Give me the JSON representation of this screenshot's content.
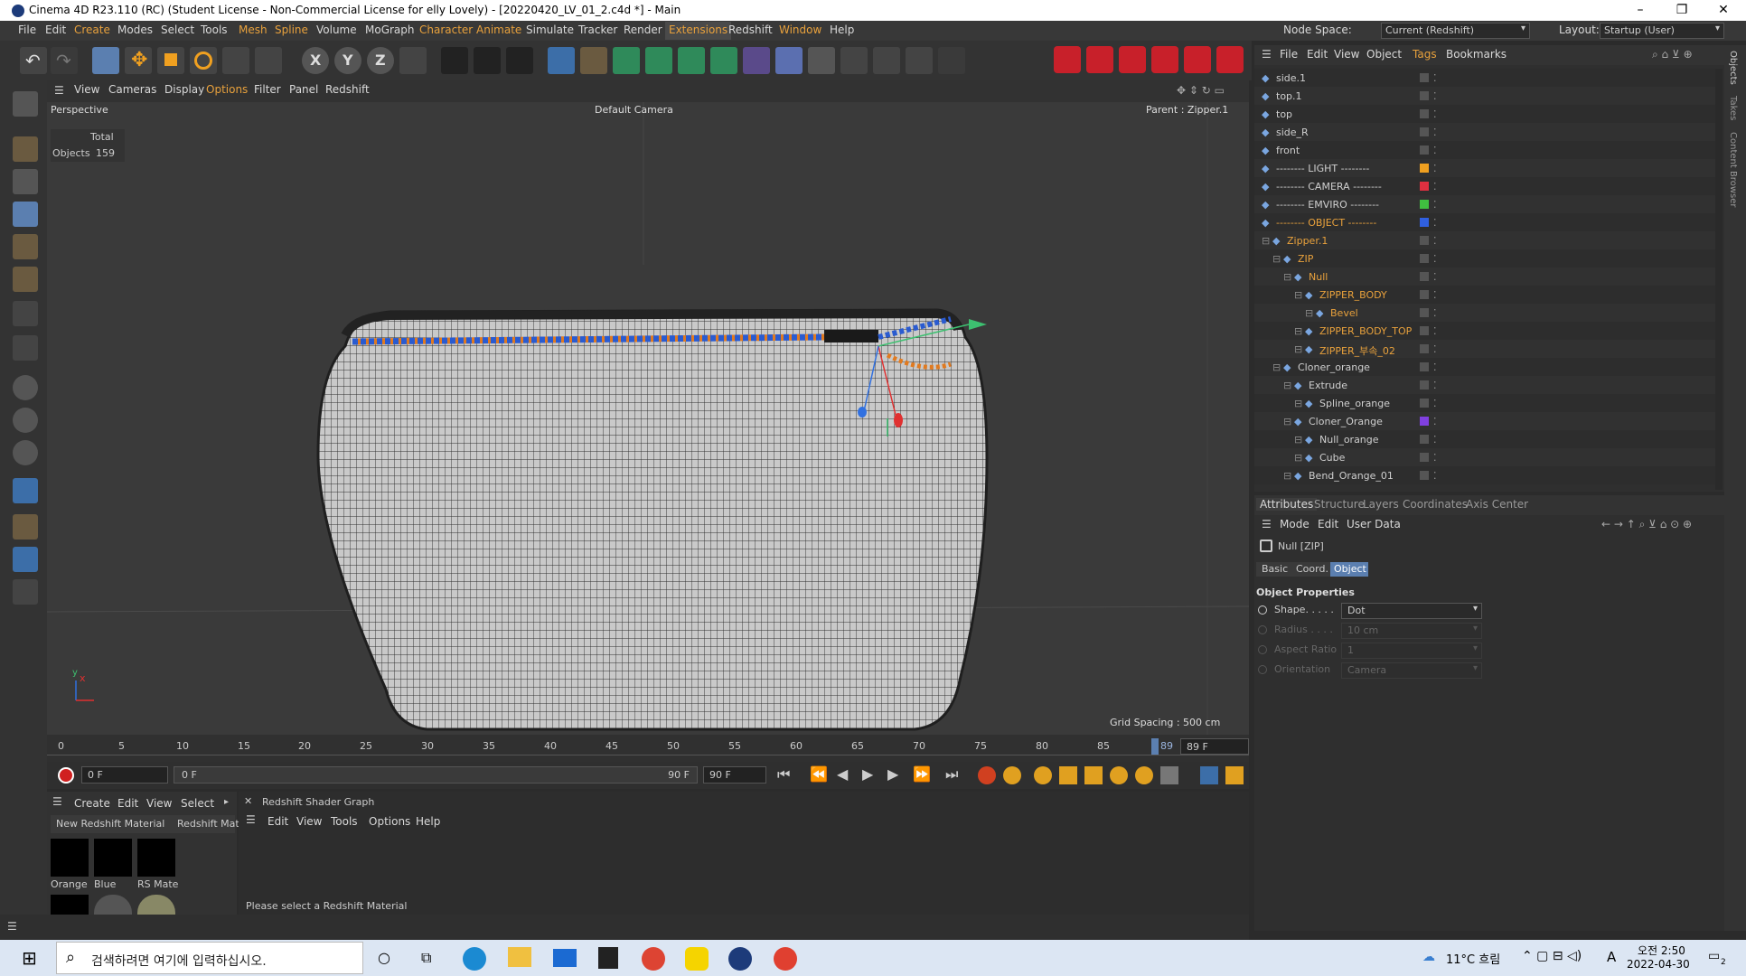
{
  "window": {
    "title": "Cinema 4D R23.110 (RC) (Student License - Non-Commercial License for elly Lovely) - [20220420_LV_01_2.c4d *] - Main",
    "controls": [
      "–",
      "❐",
      "✕"
    ]
  },
  "menubar": {
    "items": [
      "File",
      "Edit",
      "Create",
      "Modes",
      "Select",
      "Tools",
      "Mesh",
      "Spline",
      "Volume",
      "MoGraph",
      "Character",
      "Animate",
      "Simulate",
      "Tracker",
      "Render",
      "Extensions",
      "Redshift",
      "Window",
      "Help"
    ],
    "node_space_label": "Node Space:",
    "node_space_value": "Current (Redshift)",
    "layout_label": "Layout:",
    "layout_value": "Startup (User)"
  },
  "viewport_menu": {
    "items": [
      "View",
      "Cameras",
      "Display",
      "Options",
      "Filter",
      "Panel",
      "Redshift"
    ]
  },
  "viewport": {
    "mode": "Perspective",
    "camera": "Default Camera",
    "parent": "Parent : Zipper.1",
    "stats_header": "Total",
    "stats_label": "Objects",
    "stats_value": "159",
    "grid_spacing": "Grid Spacing : 500 cm",
    "axis_x": "x",
    "axis_y": "y"
  },
  "timeline": {
    "ticks": [
      "0",
      "5",
      "10",
      "15",
      "20",
      "25",
      "30",
      "35",
      "40",
      "45",
      "50",
      "55",
      "60",
      "65",
      "70",
      "75",
      "80",
      "85"
    ],
    "current_marker": "89",
    "end_frame": "89 F"
  },
  "transport": {
    "current_frame": "0 F",
    "range_start": "0 F",
    "range_end": "90 F",
    "max_frame": "90 F"
  },
  "material_panel": {
    "menu": [
      "Create",
      "Edit",
      "View",
      "Select"
    ],
    "tabs": [
      "New Redshift Material",
      "Redshift Mate"
    ],
    "materials": [
      {
        "label": "Orange",
        "color": "#000000"
      },
      {
        "label": "Blue",
        "color": "#000000"
      },
      {
        "label": "RS Mate",
        "color": "#000000"
      }
    ]
  },
  "shader_graph": {
    "title": "Redshift Shader Graph",
    "menu": [
      "Edit",
      "View",
      "Tools",
      "Options",
      "Help"
    ],
    "status": "Please select a Redshift Material"
  },
  "object_manager": {
    "menu": [
      "File",
      "Edit",
      "View",
      "Object",
      "Tags",
      "Bookmarks"
    ],
    "rows": [
      {
        "name": "side.1",
        "indent": 0,
        "color": "#cfcfcf",
        "icon": "camera-icon",
        "layer": ""
      },
      {
        "name": "top.1",
        "indent": 0,
        "color": "#cfcfcf",
        "icon": "camera-icon",
        "layer": ""
      },
      {
        "name": "top",
        "indent": 0,
        "color": "#cfcfcf",
        "icon": "camera-icon",
        "layer": ""
      },
      {
        "name": "side_R",
        "indent": 0,
        "color": "#cfcfcf",
        "icon": "camera-icon",
        "layer": ""
      },
      {
        "name": "front",
        "indent": 0,
        "color": "#cfcfcf",
        "icon": "camera-icon",
        "layer": ""
      },
      {
        "name": "-------- LIGHT --------",
        "indent": 0,
        "color": "#cfcfcf",
        "icon": "folder-icon",
        "layer": "#f0a020"
      },
      {
        "name": "-------- CAMERA --------",
        "indent": 0,
        "color": "#cfcfcf",
        "icon": "folder-icon",
        "layer": "#e03040"
      },
      {
        "name": "-------- EMVIRO --------",
        "indent": 0,
        "color": "#cfcfcf",
        "icon": "folder-icon",
        "layer": "#40c040"
      },
      {
        "name": "-------- OBJECT --------",
        "indent": 0,
        "color": "#e8a13c",
        "icon": "folder-icon",
        "layer": "#3060e0"
      },
      {
        "name": "Zipper.1",
        "indent": 1,
        "color": "#e8a13c",
        "icon": "null-icon",
        "layer": ""
      },
      {
        "name": "ZIP",
        "indent": 2,
        "color": "#e8a13c",
        "icon": "null-icon",
        "layer": ""
      },
      {
        "name": "Null",
        "indent": 3,
        "color": "#e8a13c",
        "icon": "null-icon",
        "layer": ""
      },
      {
        "name": "ZIPPER_BODY",
        "indent": 4,
        "color": "#e8a13c",
        "icon": "mesh-icon",
        "layer": ""
      },
      {
        "name": "Bevel",
        "indent": 5,
        "color": "#e8a13c",
        "icon": "bevel-icon",
        "layer": ""
      },
      {
        "name": "ZIPPER_BODY_TOP",
        "indent": 4,
        "color": "#e8a13c",
        "icon": "mesh-icon",
        "layer": ""
      },
      {
        "name": "ZIPPER_부속_02",
        "indent": 4,
        "color": "#e8a13c",
        "icon": "mesh-icon",
        "layer": ""
      },
      {
        "name": "Cloner_orange",
        "indent": 2,
        "color": "#cfcfcf",
        "icon": "null-icon",
        "layer": ""
      },
      {
        "name": "Extrude",
        "indent": 3,
        "color": "#cfcfcf",
        "icon": "extrude-icon",
        "layer": ""
      },
      {
        "name": "Spline_orange",
        "indent": 4,
        "color": "#cfcfcf",
        "icon": "spline-icon",
        "layer": ""
      },
      {
        "name": "Cloner_Orange",
        "indent": 3,
        "color": "#cfcfcf",
        "icon": "cloner-icon",
        "layer": "#8040e0"
      },
      {
        "name": "Null_orange",
        "indent": 4,
        "color": "#cfcfcf",
        "icon": "null-icon",
        "layer": ""
      },
      {
        "name": "Cube",
        "indent": 4,
        "color": "#cfcfcf",
        "icon": "cube-icon",
        "layer": ""
      },
      {
        "name": "Bend_Orange_01",
        "indent": 3,
        "color": "#cfcfcf",
        "icon": "bend-icon",
        "layer": ""
      }
    ]
  },
  "attributes": {
    "tabs": [
      "Attributes",
      "Structure",
      "Layers",
      "Coordinates",
      "Axis Center"
    ],
    "menu": [
      "Mode",
      "Edit",
      "User Data"
    ],
    "object_name": "Null [ZIP]",
    "sub_tabs": [
      "Basic",
      "Coord.",
      "Object"
    ],
    "section": "Object Properties",
    "fields": [
      {
        "label": "Shape. . . . .",
        "value": "Dot",
        "enabled": true
      },
      {
        "label": "Radius . . . .",
        "value": "10 cm",
        "enabled": false
      },
      {
        "label": "Aspect Ratio",
        "value": "1",
        "enabled": false
      },
      {
        "label": "Orientation",
        "value": "Camera",
        "enabled": false
      }
    ]
  },
  "right_strip": [
    "Objects",
    "Takes",
    "Content Browser"
  ],
  "taskbar": {
    "search_placeholder": "검색하려면 여기에 입력하십시오.",
    "weather": "11°C 흐림",
    "time": "오전 2:50",
    "date": "2022-04-30",
    "ime": "A",
    "notif": "2"
  }
}
